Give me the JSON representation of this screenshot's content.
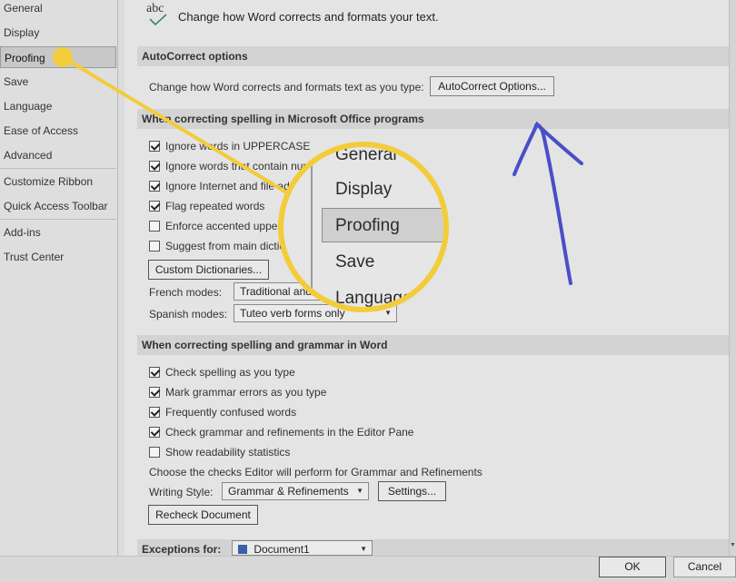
{
  "sidebar": {
    "items": [
      {
        "label": "General"
      },
      {
        "label": "Display"
      },
      {
        "label": "Proofing",
        "selected": true
      },
      {
        "label": "Save"
      },
      {
        "label": "Language"
      },
      {
        "label": "Ease of Access"
      },
      {
        "label": "Advanced"
      },
      {
        "label": "Customize Ribbon"
      },
      {
        "label": "Quick Access Toolbar"
      },
      {
        "label": "Add-ins"
      },
      {
        "label": "Trust Center"
      }
    ]
  },
  "header": {
    "icon_text": "abc",
    "description": "Change how Word corrects and formats your text."
  },
  "autocorrect": {
    "title": "AutoCorrect options",
    "label": "Change how Word corrects and formats text as you type:",
    "button": "AutoCorrect Options..."
  },
  "office_spelling": {
    "title": "When correcting spelling in Microsoft Office programs",
    "checks": [
      {
        "label": "Ignore words in UPPERCASE",
        "checked": true
      },
      {
        "label": "Ignore words that contain numbers",
        "checked": true
      },
      {
        "label": "Ignore Internet and file addresses",
        "checked": true
      },
      {
        "label": "Flag repeated words",
        "checked": true
      },
      {
        "label": "Enforce accented uppercase in French",
        "checked": false
      },
      {
        "label": "Suggest from main dictionary only",
        "checked": false
      }
    ],
    "custom_dictionaries_button": "Custom Dictionaries...",
    "french_modes_label": "French modes:",
    "french_modes_value": "Traditional and new spellings",
    "spanish_modes_label": "Spanish modes:",
    "spanish_modes_value": "Tuteo verb forms only"
  },
  "word_spelling": {
    "title": "When correcting spelling and grammar in Word",
    "checks": [
      {
        "label": "Check spelling as you type",
        "checked": true
      },
      {
        "label": "Mark grammar errors as you type",
        "checked": true
      },
      {
        "label": "Frequently confused words",
        "checked": true
      },
      {
        "label": "Check grammar and refinements in the Editor Pane",
        "checked": true
      },
      {
        "label": "Show readability statistics",
        "checked": false
      }
    ],
    "editor_label": "Choose the checks Editor will perform for Grammar and Refinements",
    "writing_style_label": "Writing Style:",
    "writing_style_value": "Grammar & Refinements",
    "settings_button": "Settings...",
    "recheck_button": "Recheck Document"
  },
  "exceptions": {
    "label": "Exceptions for:",
    "value": "Document1"
  },
  "footer": {
    "ok": "OK",
    "cancel": "Cancel"
  },
  "magnifier": {
    "items": [
      "General",
      "Display",
      "Proofing",
      "Save",
      "Language"
    ]
  },
  "colors": {
    "highlight": "#f2cc3a",
    "annotation_arrow": "#4a4ec8"
  }
}
